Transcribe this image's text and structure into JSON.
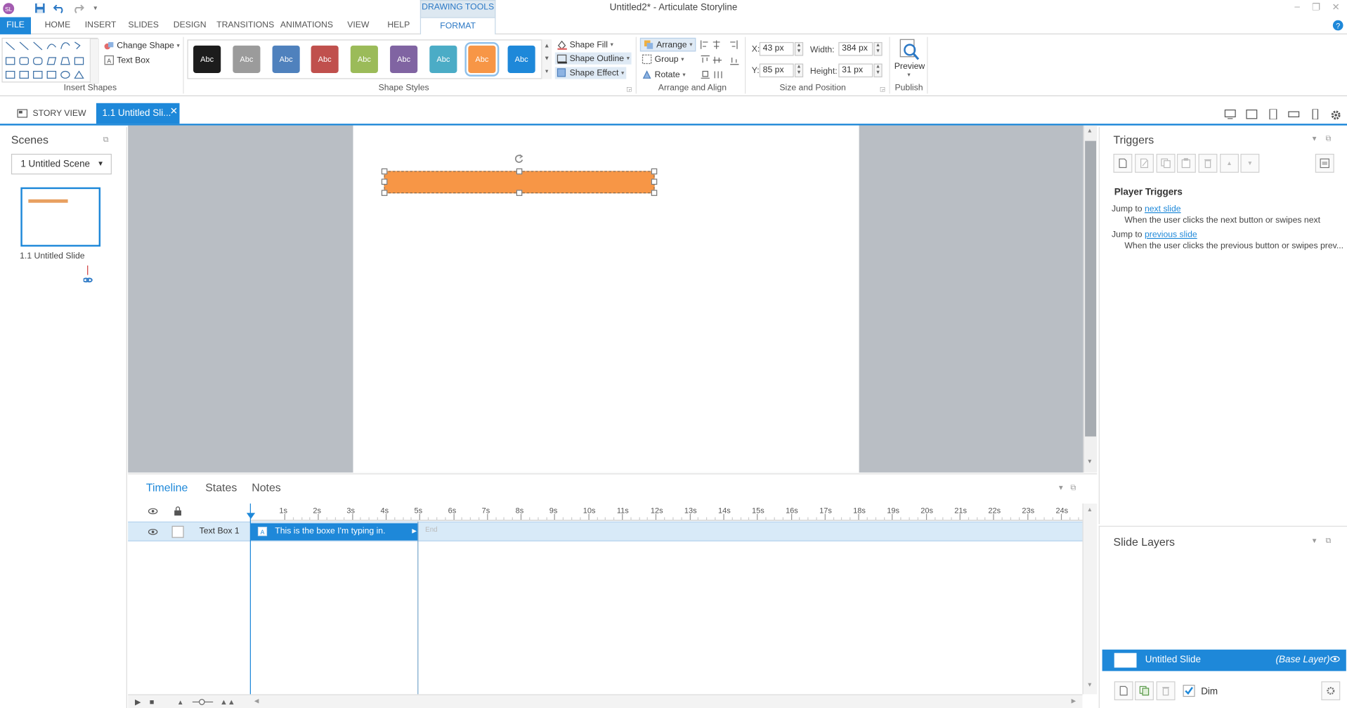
{
  "app": {
    "title": "Untitled2* -  Articulate Storyline",
    "logo": "SL",
    "drawing_tools": "DRAWING TOOLS"
  },
  "menu": {
    "tabs": [
      "FILE",
      "HOME",
      "INSERT",
      "SLIDES",
      "DESIGN",
      "TRANSITIONS",
      "ANIMATIONS",
      "VIEW",
      "HELP",
      "FORMAT"
    ]
  },
  "ribbon": {
    "insert_shapes": {
      "label": "Insert Shapes",
      "change_shape": "Change Shape",
      "text_box": "Text Box"
    },
    "shape_styles": {
      "label": "Shape Styles",
      "swatches": [
        {
          "text": "Abc",
          "color": "#1c1c1c"
        },
        {
          "text": "Abc",
          "color": "#9b9b9b"
        },
        {
          "text": "Abc",
          "color": "#4f81bd"
        },
        {
          "text": "Abc",
          "color": "#c0504d"
        },
        {
          "text": "Abc",
          "color": "#9bbb59"
        },
        {
          "text": "Abc",
          "color": "#8064a2"
        },
        {
          "text": "Abc",
          "color": "#4bacc6"
        },
        {
          "text": "Abc",
          "color": "#f79646"
        },
        {
          "text": "Abc",
          "color": "#1e88d9"
        }
      ],
      "shape_fill": "Shape Fill",
      "shape_outline": "Shape Outline",
      "shape_effect": "Shape Effect"
    },
    "arrange": {
      "label": "Arrange and Align",
      "arrange": "Arrange",
      "group": "Group",
      "rotate": "Rotate"
    },
    "size_position": {
      "label": "Size and Position",
      "x_label": "X:",
      "x_value": "43 px",
      "y_label": "Y:",
      "y_value": "85 px",
      "width_label": "Width:",
      "width_value": "384 px",
      "height_label": "Height:",
      "height_value": "31 px"
    },
    "publish": {
      "label": "Publish",
      "preview": "Preview"
    }
  },
  "subtabs": {
    "story_view": "STORY VIEW",
    "slide_tab": "1.1 Untitled Sli..."
  },
  "scenes": {
    "title": "Scenes",
    "selected_scene": "1 Untitled Scene",
    "slide_label": "1.1 Untitled Slide"
  },
  "triggers": {
    "title": "Triggers",
    "section": "Player Triggers",
    "items": [
      {
        "action": "Jump to",
        "target": "next slide",
        "condition": "When the user clicks the next button or swipes next"
      },
      {
        "action": "Jump to",
        "target": "previous slide",
        "condition": "When the user clicks the previous button or swipes prev..."
      }
    ]
  },
  "layers": {
    "title": "Slide Layers",
    "base_name": "Untitled Slide",
    "base_tag": "(Base Layer)",
    "dim": "Dim"
  },
  "timeline": {
    "tabs": [
      "Timeline",
      "States",
      "Notes"
    ],
    "ticks": [
      "1s",
      "2s",
      "3s",
      "4s",
      "5s",
      "6s",
      "7s",
      "8s",
      "9s",
      "10s",
      "11s",
      "12s",
      "13s",
      "14s",
      "15s",
      "16s",
      "17s",
      "18s",
      "19s",
      "20s",
      "21s",
      "22s",
      "23s",
      "24s"
    ],
    "row_name": "Text Box 1",
    "bar_text": "This is the boxe I'm typing in.",
    "end_label": "End"
  },
  "colors": {
    "accent": "#1e88d9",
    "shape": "#f79646",
    "stage": "#b9bec4"
  }
}
